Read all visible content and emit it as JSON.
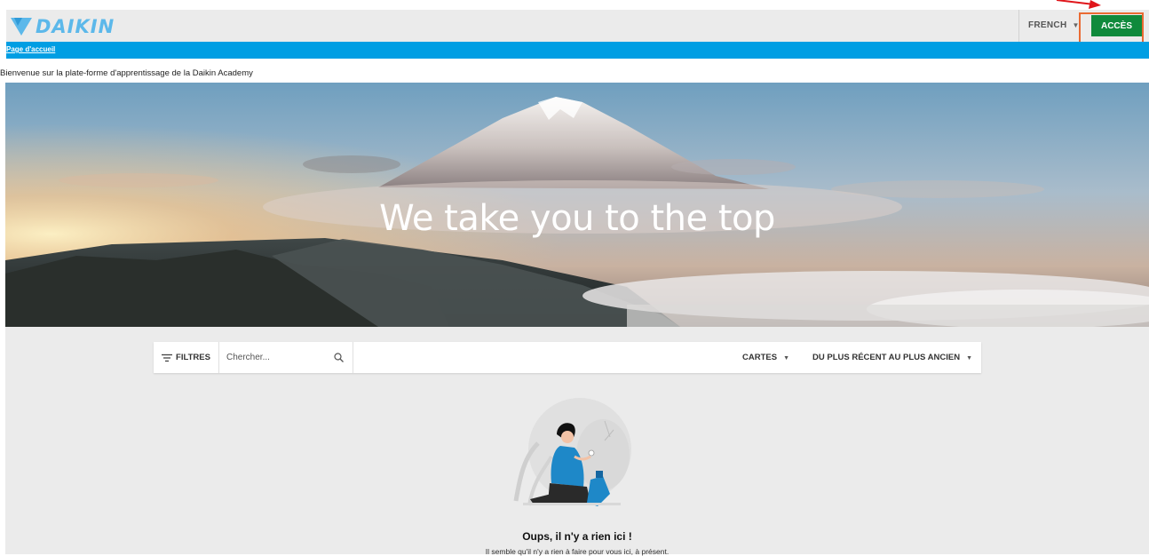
{
  "header": {
    "logo_text": "DAIKIN",
    "language_label": "FRENCH",
    "access_button_label": "ACCÈS"
  },
  "breadcrumb": {
    "home_link": "Page d'accueil"
  },
  "welcome_text": "Bienvenue sur la plate-forme d'apprentissage de la Daikin Academy",
  "hero": {
    "title": "We take you to the top"
  },
  "toolbar": {
    "filters_label": "FILTRES",
    "search_placeholder": "Chercher...",
    "view_label": "CARTES",
    "sort_label": "DU PLUS RÉCENT AU PLUS ANCIEN"
  },
  "empty_state": {
    "title": "Oups, il n'y a rien ici !",
    "subtitle": "Il semble qu'il n'y a rien à faire pour vous ici, à présent."
  },
  "colors": {
    "brand_blue": "#009ee3",
    "logo_blue": "#5cb8ea",
    "access_green": "#0f8a3c",
    "highlight_orange": "#ea6a33",
    "annotation_red": "#e0161b"
  }
}
